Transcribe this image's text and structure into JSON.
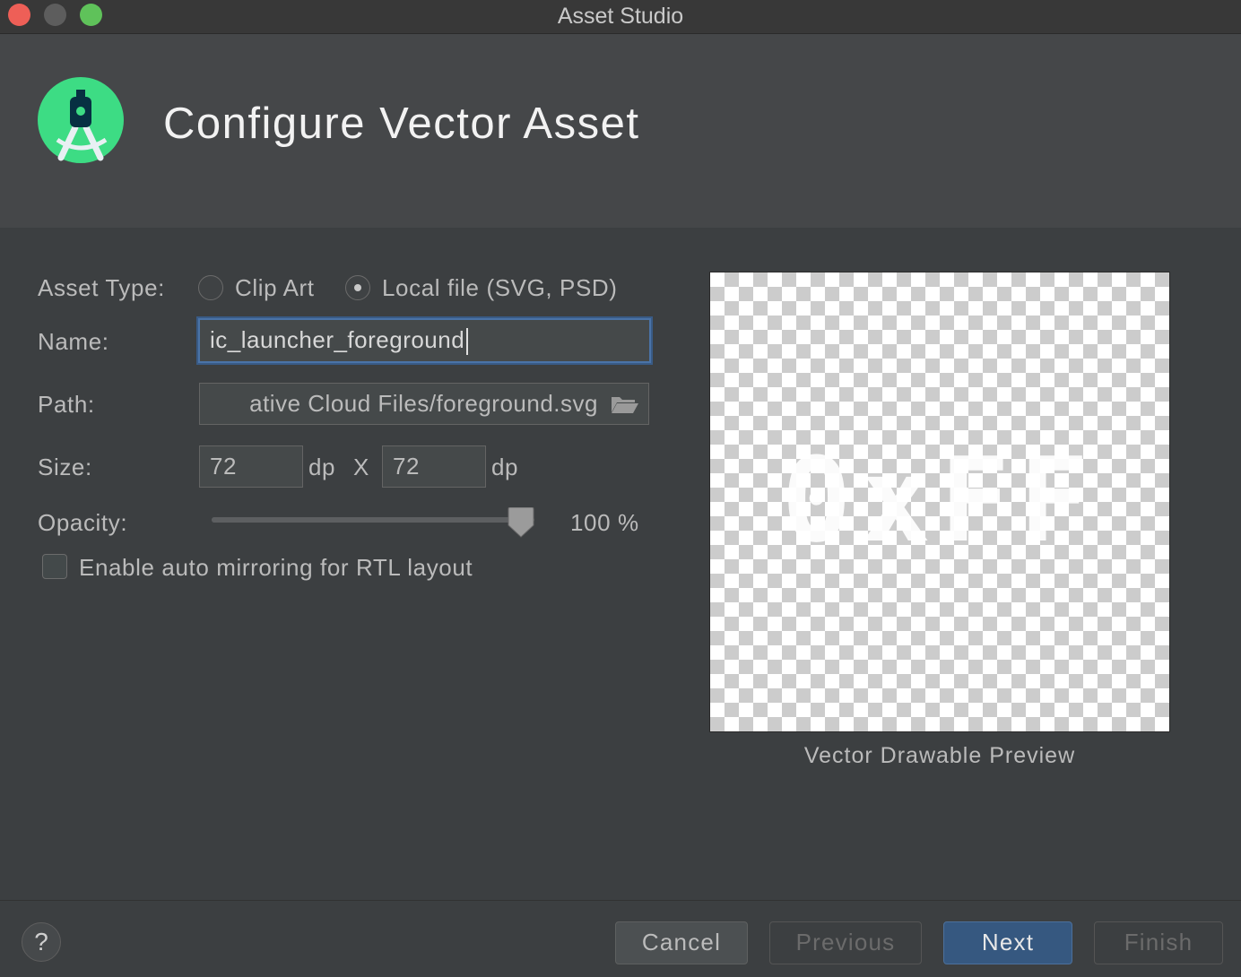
{
  "window": {
    "title": "Asset Studio"
  },
  "header": {
    "title": "Configure Vector Asset",
    "logo_icon": "android-studio-icon"
  },
  "form": {
    "asset_type_label": "Asset Type:",
    "asset_type_options": [
      {
        "label": "Clip Art",
        "selected": false
      },
      {
        "label": "Local file (SVG, PSD)",
        "selected": true
      }
    ],
    "name_label": "Name:",
    "name_value": "ic_launcher_foreground",
    "path_label": "Path:",
    "path_value": "ative Cloud Files/foreground.svg",
    "path_icon": "folder-open-icon",
    "size_label": "Size:",
    "width_value": "72",
    "width_unit": "dp",
    "size_separator": "X",
    "height_value": "72",
    "height_unit": "dp",
    "opacity_label": "Opacity:",
    "opacity_value": 100,
    "opacity_text": "100 %",
    "rtl_checkbox_label": "Enable auto mirroring for RTL layout",
    "rtl_checked": false
  },
  "preview": {
    "content_text": "0xFF",
    "caption": "Vector Drawable Preview"
  },
  "footer": {
    "help_label": "?",
    "cancel_label": "Cancel",
    "previous_label": "Previous",
    "next_label": "Next",
    "finish_label": "Finish"
  },
  "colors": {
    "background": "#3c3f41",
    "header_background": "#454749",
    "focus_border": "#4a73a7",
    "primary_button": "#365880",
    "logo_green": "#3ddc84"
  }
}
